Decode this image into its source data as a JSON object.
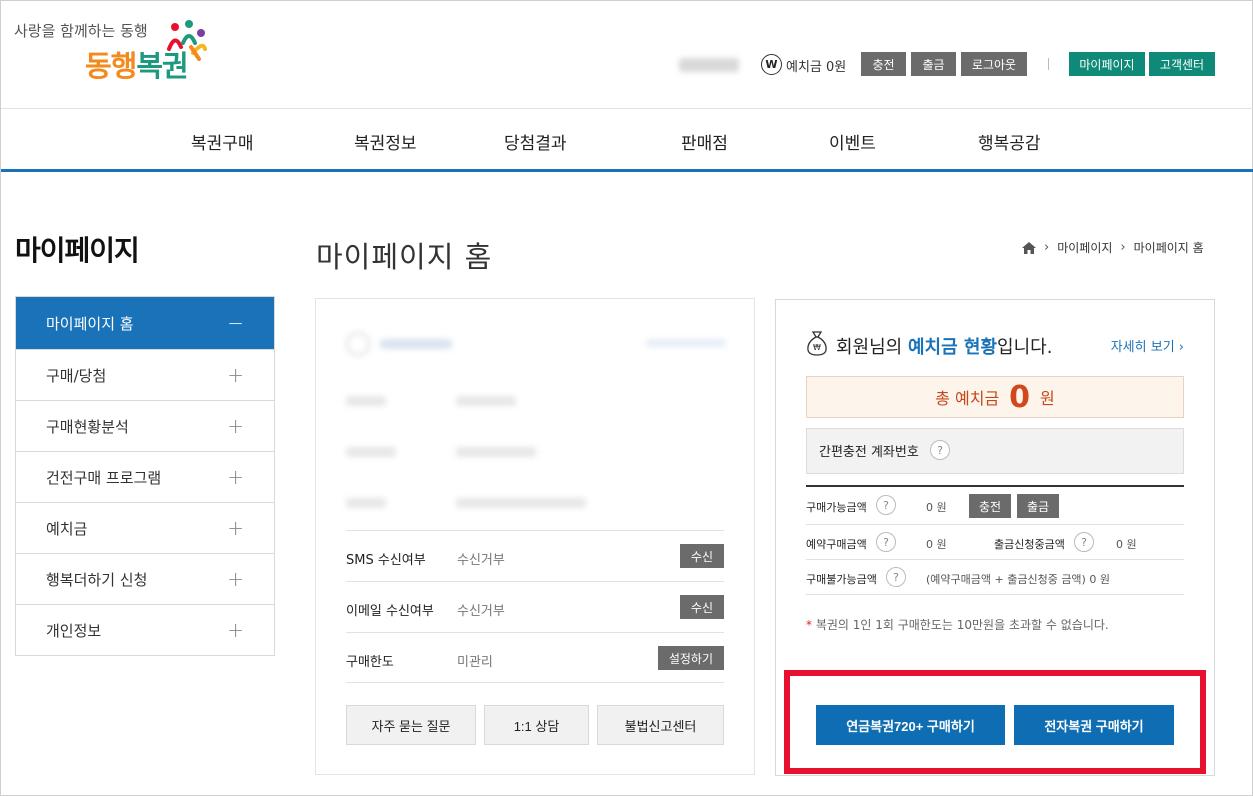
{
  "header": {
    "slogan": "사랑을 함께하는 동행",
    "logo_part1": "동행",
    "logo_part2": "복권",
    "won_symbol": "W",
    "deposit_label": "예치금 0원",
    "buttons": [
      "충전",
      "출금",
      "로그아웃"
    ],
    "right_buttons": [
      "마이페이지",
      "고객센터"
    ]
  },
  "nav": {
    "items": [
      "복권구매",
      "복권정보",
      "당첨결과",
      "판매점",
      "이벤트",
      "행복공감"
    ]
  },
  "sidebar": {
    "title": "마이페이지",
    "items": [
      {
        "label": "마이페이지 홈",
        "sign": "−"
      },
      {
        "label": "구매/당첨",
        "sign": "+"
      },
      {
        "label": "구매현황분석",
        "sign": "+"
      },
      {
        "label": "건전구매 프로그램",
        "sign": "+"
      },
      {
        "label": "예치금",
        "sign": "+"
      },
      {
        "label": "행복더하기 신청",
        "sign": "+"
      },
      {
        "label": "개인정보",
        "sign": "+"
      }
    ]
  },
  "main": {
    "page_title": "마이페이지 홈",
    "breadcrumb": [
      "마이페이지",
      "마이페이지 홈"
    ],
    "info_rows": [
      {
        "label": "SMS 수신여부",
        "value": "수신거부",
        "button": "수신"
      },
      {
        "label": "이메일 수신여부",
        "value": "수신거부",
        "button": "수신"
      },
      {
        "label": "구매한도",
        "value": "미관리",
        "button": "설정하기"
      }
    ],
    "card_buttons": [
      "자주 묻는 질문",
      "1:1 상담",
      "불법신고센터"
    ]
  },
  "deposit_panel": {
    "title_prefix": "회원님의 ",
    "title_highlight": "예치금 현황",
    "title_suffix": "입니다.",
    "detail_link": "자세히 보기",
    "total_label": "총 예치금",
    "total_value": "0",
    "total_unit": "원",
    "account_label": "간편충전 계좌번호",
    "qmark": "?",
    "rows": {
      "available_label": "구매가능금액",
      "available_value": "0 원",
      "charge_button": "충전",
      "withdraw_button": "출금",
      "reserved_label": "예약구매금액",
      "reserved_value": "0 원",
      "withdraw_req_label": "출금신청중금액",
      "withdraw_req_value": "0 원",
      "unavailable_label": "구매불가능금액",
      "unavailable_value": "(예약구매금액 + 출금신청중 금액)  0 원"
    },
    "note_star": "*",
    "note": " 복권의 1인 1회 구매한도는 10만원을 초과할 수 없습니다.",
    "buy_pension": "연금복권720+ 구매하기",
    "buy_electronic": "전자복권 구매하기"
  },
  "colors": {
    "primary": "#1a73b8",
    "teal": "#0f8a78",
    "highlight_border": "#e8112d",
    "total_red": "#d2481a"
  }
}
